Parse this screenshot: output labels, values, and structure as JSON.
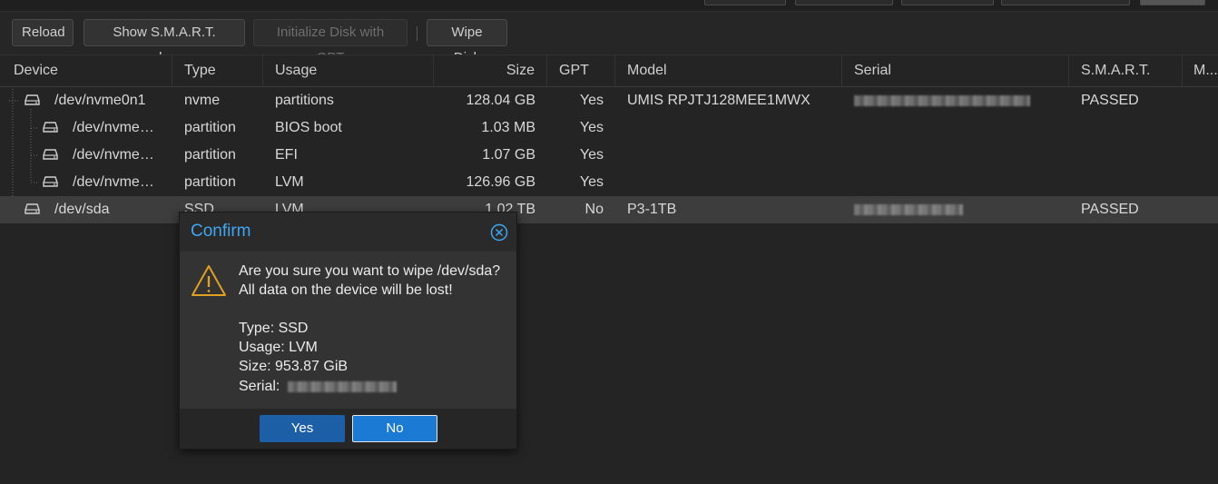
{
  "toolbar": {
    "reload": "Reload",
    "show_smart": "Show S.M.A.R.T. values",
    "init_gpt": "Initialize Disk with GPT",
    "wipe": "Wipe Disk"
  },
  "columns": {
    "device": "Device",
    "type": "Type",
    "usage": "Usage",
    "size": "Size",
    "gpt": "GPT",
    "model": "Model",
    "serial": "Serial",
    "smart": "S.M.A.R.T.",
    "more": "M..."
  },
  "rows": [
    {
      "device": "/dev/nvme0n1",
      "type": "nvme",
      "usage": "partitions",
      "size": "128.04 GB",
      "gpt": "Yes",
      "model": "UMIS RPJTJ128MEE1MWX",
      "smart": "PASSED"
    },
    {
      "device": "/dev/nvme0n...",
      "type": "partition",
      "usage": "BIOS boot",
      "size": "1.03 MB",
      "gpt": "Yes",
      "model": "",
      "smart": ""
    },
    {
      "device": "/dev/nvme0n...",
      "type": "partition",
      "usage": "EFI",
      "size": "1.07 GB",
      "gpt": "Yes",
      "model": "",
      "smart": ""
    },
    {
      "device": "/dev/nvme0n...",
      "type": "partition",
      "usage": "LVM",
      "size": "126.96 GB",
      "gpt": "Yes",
      "model": "",
      "smart": ""
    },
    {
      "device": "/dev/sda",
      "type": "SSD",
      "usage": "LVM",
      "size": "1.02 TB",
      "gpt": "No",
      "model": "P3-1TB",
      "smart": "PASSED"
    }
  ],
  "dialog": {
    "title": "Confirm",
    "line1": "Are you sure you want to wipe /dev/sda?",
    "line2": "All data on the device will be lost!",
    "type_line": "Type: SSD",
    "usage_line": "Usage: LVM",
    "size_line": "Size: 953.87 GiB",
    "serial_label": "Serial:",
    "yes": "Yes",
    "no": "No"
  },
  "colors": {
    "accent": "#3fa7f0",
    "yes_button": "#1d5fa6",
    "no_button": "#1a7ad4",
    "warning_icon": "#e0a020"
  }
}
